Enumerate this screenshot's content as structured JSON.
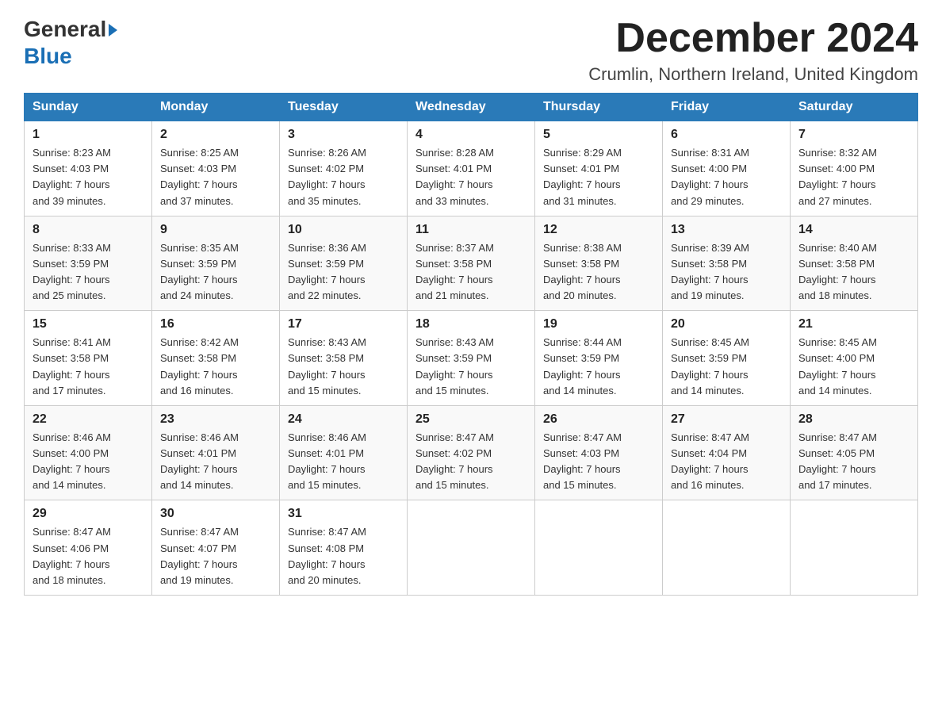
{
  "logo": {
    "general": "General",
    "blue": "Blue"
  },
  "title": "December 2024",
  "location": "Crumlin, Northern Ireland, United Kingdom",
  "days_of_week": [
    "Sunday",
    "Monday",
    "Tuesday",
    "Wednesday",
    "Thursday",
    "Friday",
    "Saturday"
  ],
  "weeks": [
    [
      {
        "day": "1",
        "info": "Sunrise: 8:23 AM\nSunset: 4:03 PM\nDaylight: 7 hours\nand 39 minutes."
      },
      {
        "day": "2",
        "info": "Sunrise: 8:25 AM\nSunset: 4:03 PM\nDaylight: 7 hours\nand 37 minutes."
      },
      {
        "day": "3",
        "info": "Sunrise: 8:26 AM\nSunset: 4:02 PM\nDaylight: 7 hours\nand 35 minutes."
      },
      {
        "day": "4",
        "info": "Sunrise: 8:28 AM\nSunset: 4:01 PM\nDaylight: 7 hours\nand 33 minutes."
      },
      {
        "day": "5",
        "info": "Sunrise: 8:29 AM\nSunset: 4:01 PM\nDaylight: 7 hours\nand 31 minutes."
      },
      {
        "day": "6",
        "info": "Sunrise: 8:31 AM\nSunset: 4:00 PM\nDaylight: 7 hours\nand 29 minutes."
      },
      {
        "day": "7",
        "info": "Sunrise: 8:32 AM\nSunset: 4:00 PM\nDaylight: 7 hours\nand 27 minutes."
      }
    ],
    [
      {
        "day": "8",
        "info": "Sunrise: 8:33 AM\nSunset: 3:59 PM\nDaylight: 7 hours\nand 25 minutes."
      },
      {
        "day": "9",
        "info": "Sunrise: 8:35 AM\nSunset: 3:59 PM\nDaylight: 7 hours\nand 24 minutes."
      },
      {
        "day": "10",
        "info": "Sunrise: 8:36 AM\nSunset: 3:59 PM\nDaylight: 7 hours\nand 22 minutes."
      },
      {
        "day": "11",
        "info": "Sunrise: 8:37 AM\nSunset: 3:58 PM\nDaylight: 7 hours\nand 21 minutes."
      },
      {
        "day": "12",
        "info": "Sunrise: 8:38 AM\nSunset: 3:58 PM\nDaylight: 7 hours\nand 20 minutes."
      },
      {
        "day": "13",
        "info": "Sunrise: 8:39 AM\nSunset: 3:58 PM\nDaylight: 7 hours\nand 19 minutes."
      },
      {
        "day": "14",
        "info": "Sunrise: 8:40 AM\nSunset: 3:58 PM\nDaylight: 7 hours\nand 18 minutes."
      }
    ],
    [
      {
        "day": "15",
        "info": "Sunrise: 8:41 AM\nSunset: 3:58 PM\nDaylight: 7 hours\nand 17 minutes."
      },
      {
        "day": "16",
        "info": "Sunrise: 8:42 AM\nSunset: 3:58 PM\nDaylight: 7 hours\nand 16 minutes."
      },
      {
        "day": "17",
        "info": "Sunrise: 8:43 AM\nSunset: 3:58 PM\nDaylight: 7 hours\nand 15 minutes."
      },
      {
        "day": "18",
        "info": "Sunrise: 8:43 AM\nSunset: 3:59 PM\nDaylight: 7 hours\nand 15 minutes."
      },
      {
        "day": "19",
        "info": "Sunrise: 8:44 AM\nSunset: 3:59 PM\nDaylight: 7 hours\nand 14 minutes."
      },
      {
        "day": "20",
        "info": "Sunrise: 8:45 AM\nSunset: 3:59 PM\nDaylight: 7 hours\nand 14 minutes."
      },
      {
        "day": "21",
        "info": "Sunrise: 8:45 AM\nSunset: 4:00 PM\nDaylight: 7 hours\nand 14 minutes."
      }
    ],
    [
      {
        "day": "22",
        "info": "Sunrise: 8:46 AM\nSunset: 4:00 PM\nDaylight: 7 hours\nand 14 minutes."
      },
      {
        "day": "23",
        "info": "Sunrise: 8:46 AM\nSunset: 4:01 PM\nDaylight: 7 hours\nand 14 minutes."
      },
      {
        "day": "24",
        "info": "Sunrise: 8:46 AM\nSunset: 4:01 PM\nDaylight: 7 hours\nand 15 minutes."
      },
      {
        "day": "25",
        "info": "Sunrise: 8:47 AM\nSunset: 4:02 PM\nDaylight: 7 hours\nand 15 minutes."
      },
      {
        "day": "26",
        "info": "Sunrise: 8:47 AM\nSunset: 4:03 PM\nDaylight: 7 hours\nand 15 minutes."
      },
      {
        "day": "27",
        "info": "Sunrise: 8:47 AM\nSunset: 4:04 PM\nDaylight: 7 hours\nand 16 minutes."
      },
      {
        "day": "28",
        "info": "Sunrise: 8:47 AM\nSunset: 4:05 PM\nDaylight: 7 hours\nand 17 minutes."
      }
    ],
    [
      {
        "day": "29",
        "info": "Sunrise: 8:47 AM\nSunset: 4:06 PM\nDaylight: 7 hours\nand 18 minutes."
      },
      {
        "day": "30",
        "info": "Sunrise: 8:47 AM\nSunset: 4:07 PM\nDaylight: 7 hours\nand 19 minutes."
      },
      {
        "day": "31",
        "info": "Sunrise: 8:47 AM\nSunset: 4:08 PM\nDaylight: 7 hours\nand 20 minutes."
      },
      {
        "day": "",
        "info": ""
      },
      {
        "day": "",
        "info": ""
      },
      {
        "day": "",
        "info": ""
      },
      {
        "day": "",
        "info": ""
      }
    ]
  ]
}
